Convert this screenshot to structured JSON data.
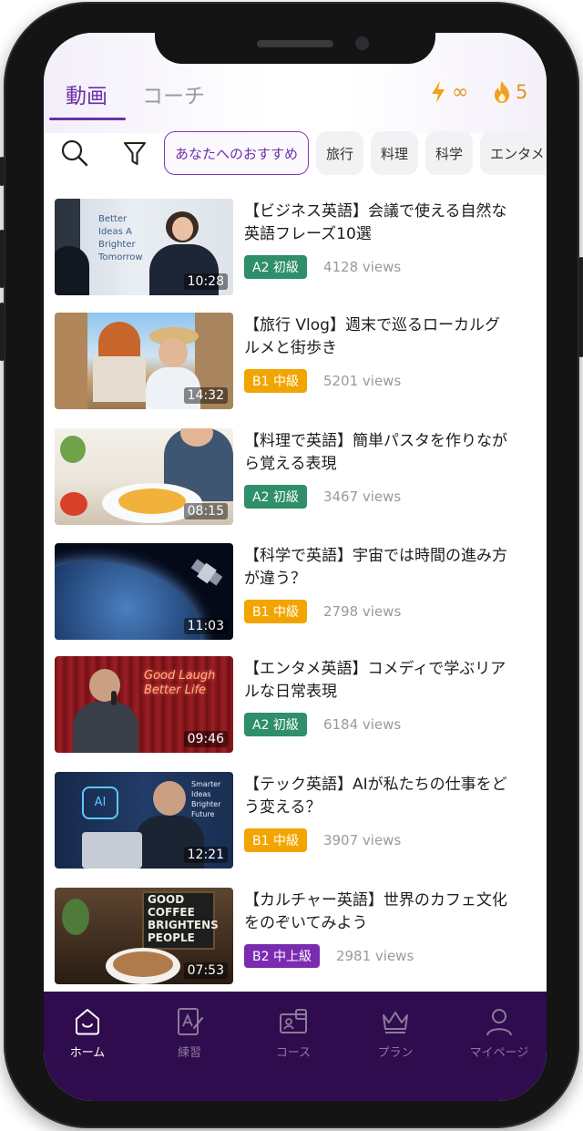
{
  "header": {
    "tabs": [
      {
        "label": "動画",
        "active": true
      },
      {
        "label": "コーチ",
        "active": false
      }
    ],
    "energy": {
      "icon": "lightning-icon",
      "value": "∞"
    },
    "streak": {
      "icon": "flame-icon",
      "value": "5"
    },
    "accent_color": "#6d2fa8"
  },
  "filters": {
    "search_icon": "search-icon",
    "filter_icon": "funnel-icon",
    "chips": [
      {
        "label": "あなたへのおすすめ",
        "active": true
      },
      {
        "label": "旅行",
        "active": false
      },
      {
        "label": "料理",
        "active": false
      },
      {
        "label": "科学",
        "active": false
      },
      {
        "label": "エンタメ",
        "active": false
      }
    ]
  },
  "videos": [
    {
      "title": "【ビジネス英語】会議で使える自然な英語フレーズ10選",
      "duration": "10:28",
      "level": "A2 初級",
      "level_color": "#2e8f6a",
      "views": "4128 views",
      "thumb_text": "Better Ideas A Brighter Tomorrow"
    },
    {
      "title": "【旅行 Vlog】週末で巡るローカルグルメと街歩き",
      "duration": "14:32",
      "level": "B1 中級",
      "level_color": "#f2a500",
      "views": "5201 views"
    },
    {
      "title": "【料理で英語】簡単パスタを作りながら覚える表現",
      "duration": "08:15",
      "level": "A2 初級",
      "level_color": "#2e8f6a",
      "views": "3467 views"
    },
    {
      "title": "【科学で英語】宇宙では時間の進み方が違う？",
      "duration": "11:03",
      "level": "B1 中級",
      "level_color": "#f2a500",
      "views": "2798 views"
    },
    {
      "title": "【エンタメ英語】コメディで学ぶリアルな日常表現",
      "duration": "09:46",
      "level": "A2 初級",
      "level_color": "#2e8f6a",
      "views": "6184 views",
      "thumb_text": "Good Laugh Better Life"
    },
    {
      "title": "【テック英語】AIが私たちの仕事をどう変える？",
      "duration": "12:21",
      "level": "B1 中級",
      "level_color": "#f2a500",
      "views": "3907 views",
      "thumb_text": "Smarter Ideas Brighter Future"
    },
    {
      "title": "【カルチャー英語】世界のカフェ文化をのぞいてみよう",
      "duration": "07:53",
      "level": "B2 中上級",
      "level_color": "#7b2bb0",
      "views": "2981 views",
      "thumb_text": "GOOD COFFEE BRIGHTENS PEOPLE"
    }
  ],
  "bottom_nav": {
    "background": "#2f0c4d",
    "items": [
      {
        "label": "ホーム",
        "icon": "home-icon",
        "active": true
      },
      {
        "label": "練習",
        "icon": "practice-icon",
        "active": false
      },
      {
        "label": "コース",
        "icon": "course-icon",
        "active": false
      },
      {
        "label": "プラン",
        "icon": "crown-icon",
        "active": false
      },
      {
        "label": "マイページ",
        "icon": "profile-icon",
        "active": false
      }
    ]
  }
}
